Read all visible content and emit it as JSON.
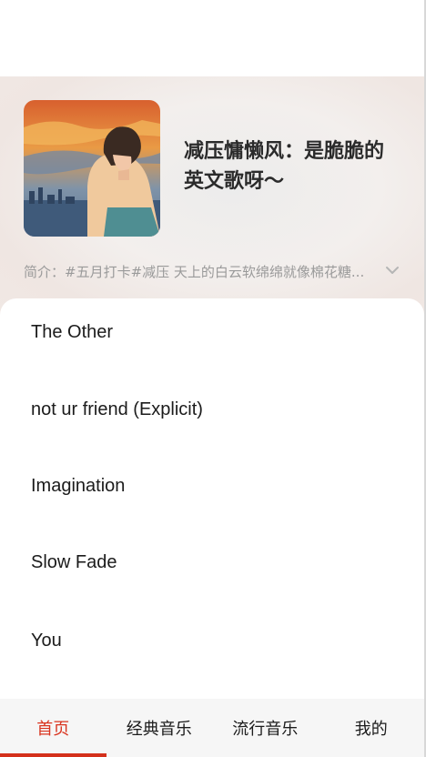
{
  "playlist": {
    "title": "减压慵懒风：是脆脆的英文歌呀～",
    "intro": "简介：#五月打卡#减压 天上的白云软绵绵就像棉花糖...",
    "cover_icon": "playlist-cover-illustration",
    "expand_icon": "chevron-down-icon"
  },
  "songs": [
    {
      "title": "The Other"
    },
    {
      "title": "not ur friend (Explicit)"
    },
    {
      "title": "Imagination"
    },
    {
      "title": "Slow Fade"
    },
    {
      "title": "You"
    }
  ],
  "tabs": [
    {
      "label": "首页",
      "active": true
    },
    {
      "label": "经典音乐",
      "active": false
    },
    {
      "label": "流行音乐",
      "active": false
    },
    {
      "label": "我的",
      "active": false
    }
  ],
  "colors": {
    "accent": "#d4301b",
    "tabbar_bg": "#f6f6f6",
    "intro_text": "#9a9a9a"
  }
}
